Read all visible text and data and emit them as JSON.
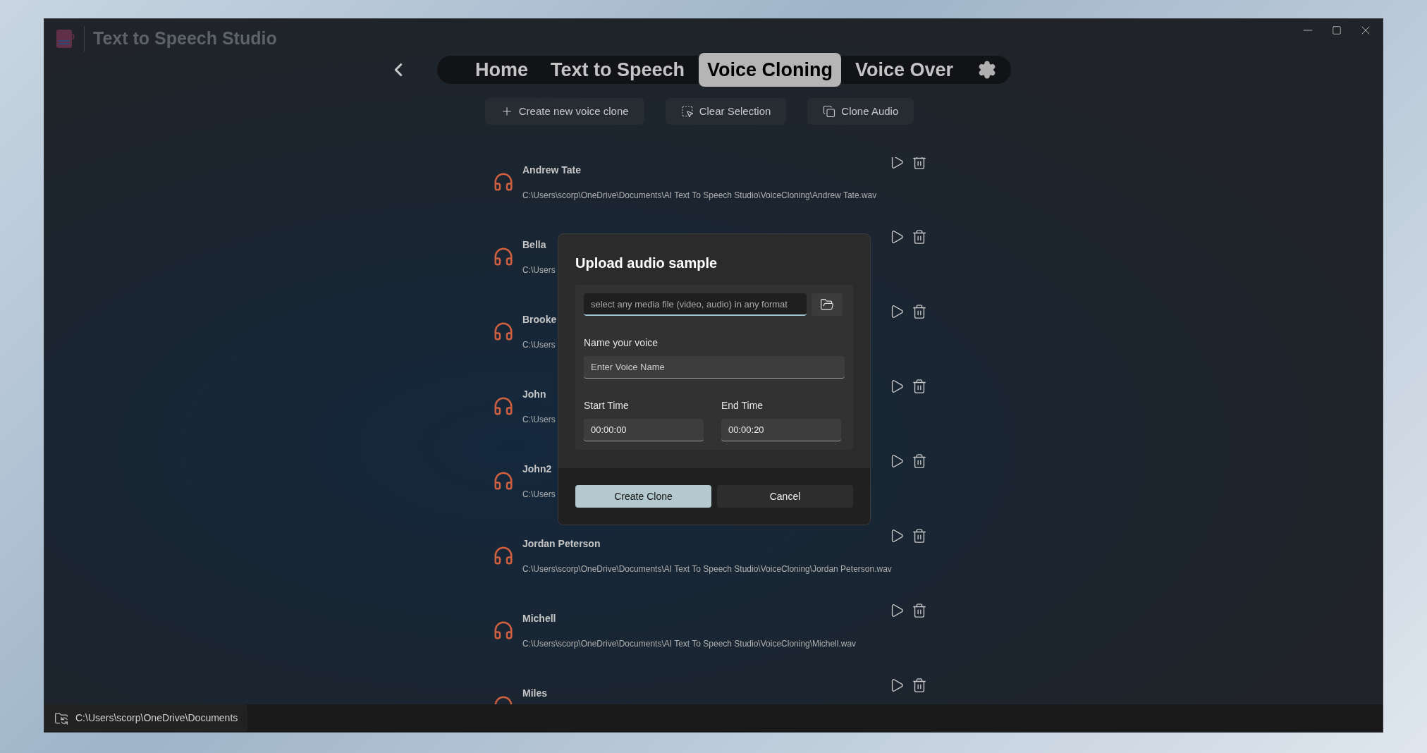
{
  "window": {
    "title": "Text to Speech Studio"
  },
  "tabs": [
    {
      "label": "Home",
      "selected": false
    },
    {
      "label": "Text to Speech",
      "selected": false
    },
    {
      "label": "Voice Cloning",
      "selected": true
    },
    {
      "label": "Voice Over",
      "selected": false
    }
  ],
  "toolbar": [
    {
      "kind": "add",
      "label": "Create new voice clone"
    },
    {
      "kind": "select",
      "label": "Clear Selection"
    },
    {
      "kind": "copy",
      "label": "Clone Audio"
    }
  ],
  "voices": [
    {
      "name": "Andrew Tate",
      "path": "C:\\Users\\scorp\\OneDrive\\Documents\\AI Text To Speech Studio\\VoiceCloning\\Andrew Tate.wav"
    },
    {
      "name": "Bella",
      "path": "C:\\Users"
    },
    {
      "name": "Brooke",
      "path": "C:\\Users"
    },
    {
      "name": "John",
      "path": "C:\\Users"
    },
    {
      "name": "John2",
      "path": "C:\\Users"
    },
    {
      "name": "Jordan Peterson",
      "path": "C:\\Users\\scorp\\OneDrive\\Documents\\AI Text To Speech Studio\\VoiceCloning\\Jordan Peterson.wav"
    },
    {
      "name": "Michell",
      "path": "C:\\Users\\scorp\\OneDrive\\Documents\\AI Text To Speech Studio\\VoiceCloning\\Michell.wav"
    },
    {
      "name": "Miles"
    }
  ],
  "dialog": {
    "title": "Upload audio sample",
    "file_placeholder": "select any media file (video, audio) in any format",
    "name_label": "Name your voice",
    "name_placeholder": "Enter Voice Name",
    "start_label": "Start Time",
    "start_value": "00:00:00",
    "end_label": "End Time",
    "end_value": "00:00:20",
    "primary_button": "Create Clone",
    "secondary_button": "Cancel"
  },
  "status_bar": {
    "path": "C:\\Users\\scorp\\OneDrive\\Documents"
  }
}
